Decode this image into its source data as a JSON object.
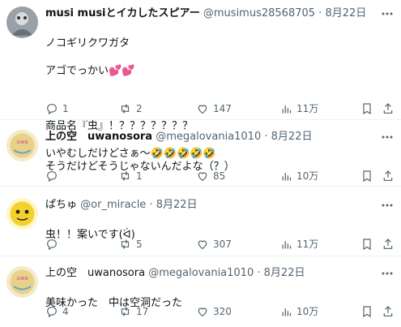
{
  "replies": [
    {
      "name": "musi musiとイカしたスピアー",
      "handle": "@musimus28568705",
      "dot": "·",
      "date": "8月22日",
      "text_lines": [
        "ノコギリクワガタ",
        "アゴでっかい💕💕",
        "",
        "商品名『虫』！？？？？？？？",
        "いやむしだけどさぁ～🤣🤣🤣🤣🤣"
      ],
      "stats": {
        "replies": "1",
        "retweets": "2",
        "likes": "147",
        "views": "11万"
      }
    },
    {
      "name": "上の空　uwanosora",
      "handle": "@megalovania1010",
      "dot": "·",
      "date": "8月22日",
      "text_lines": [
        "そうだけどそうじゃないんだよな（？）"
      ],
      "stats": {
        "replies": "",
        "retweets": "1",
        "likes": "85",
        "views": "10万"
      }
    },
    {
      "name": "ぱちゅ",
      "handle": "@or_miracle",
      "dot": "·",
      "date": "8月22日",
      "text_lines": [
        "虫！！案いです(ᐛ)"
      ],
      "stats": {
        "replies": "",
        "retweets": "5",
        "likes": "307",
        "views": "11万"
      }
    },
    {
      "name": "上の空　uwanosora",
      "handle": "@megalovania1010",
      "dot": "·",
      "date": "8月22日",
      "text_lines": [
        "美味かった　中は空洞だった"
      ],
      "stats": {
        "replies": "4",
        "retweets": "17",
        "likes": "320",
        "views": "10万"
      }
    }
  ],
  "colors": {
    "text": "#0f1419",
    "secondary": "#536471",
    "divider": "#eff3f4"
  }
}
